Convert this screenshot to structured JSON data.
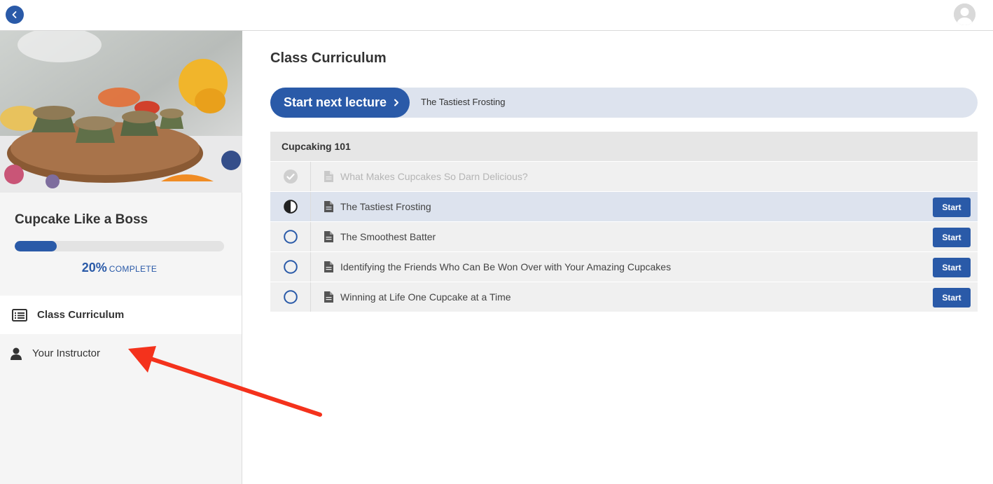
{
  "header": {
    "back_icon": "chevron-left-icon",
    "avatar_icon": "user-avatar-icon"
  },
  "sidebar": {
    "course_title": "Cupcake Like a Boss",
    "progress_fraction": 0.2,
    "progress_pct_label": "20%",
    "progress_word": "COMPLETE",
    "nav": [
      {
        "label": "Class Curriculum",
        "icon": "list-icon",
        "active": true
      },
      {
        "label": "Your Instructor",
        "icon": "user-icon",
        "active": false
      }
    ]
  },
  "main": {
    "title": "Class Curriculum",
    "next_button_label": "Start next lecture",
    "next_lecture_title": "The Tastiest Frosting",
    "section": {
      "title": "Cupcaking 101",
      "lectures": [
        {
          "title": "What Makes Cupcakes So Darn Delicious?",
          "status": "complete",
          "button": ""
        },
        {
          "title": "The Tastiest Frosting",
          "status": "in-progress",
          "button": "Start"
        },
        {
          "title": "The Smoothest Batter",
          "status": "not-started",
          "button": "Start"
        },
        {
          "title": "Identifying the Friends Who Can Be Won Over with Your Amazing Cupcakes",
          "status": "not-started",
          "button": "Start"
        },
        {
          "title": "Winning at Life One Cupcake at a Time",
          "status": "not-started",
          "button": "Start"
        }
      ]
    }
  },
  "colors": {
    "accent": "#2a5aa8",
    "row_bg": "#f0f0f0",
    "current_row_bg": "#dde3ee",
    "annotation_arrow": "#f4321c"
  }
}
